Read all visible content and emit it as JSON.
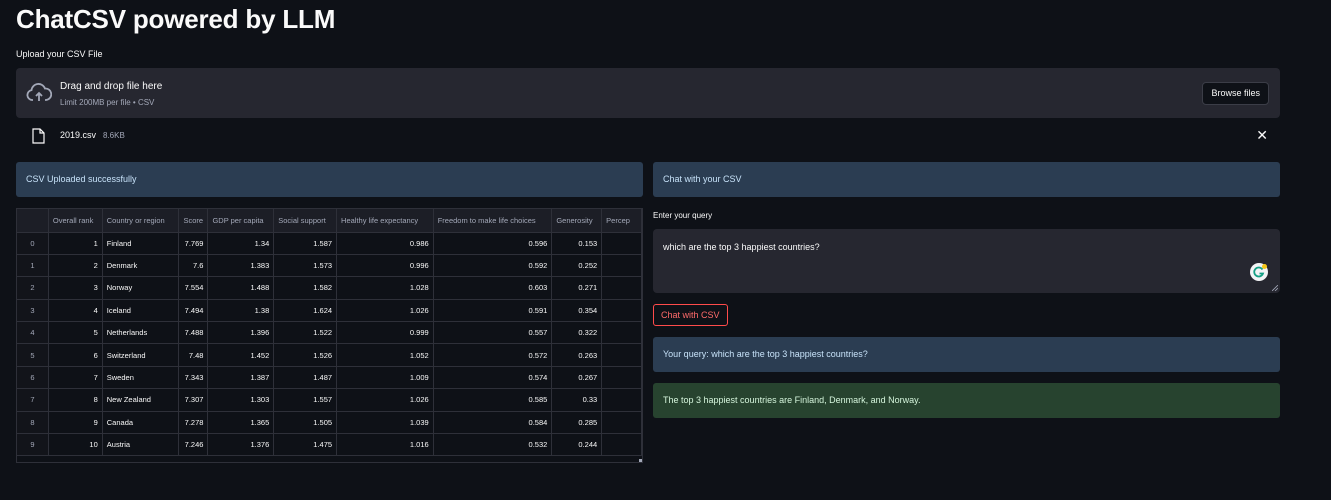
{
  "app": {
    "title": "ChatCSV powered by LLM"
  },
  "uploader": {
    "label": "Upload your CSV File",
    "drop_title": "Drag and drop file here",
    "drop_limit": "Limit 200MB per file • CSV",
    "browse_label": "Browse files",
    "file_name": "2019.csv",
    "file_size": "8.6KB"
  },
  "left_panel": {
    "upload_success": "CSV Uploaded successfully"
  },
  "table": {
    "columns": [
      "",
      "Overall rank",
      "Country or region",
      "Score",
      "GDP per capita",
      "Social support",
      "Healthy life expectancy",
      "Freedom to make life choices",
      "Generosity",
      "Percep"
    ],
    "rows": [
      [
        "0",
        "1",
        "Finland",
        "7.769",
        "1.34",
        "1.587",
        "0.986",
        "0.596",
        "0.153"
      ],
      [
        "1",
        "2",
        "Denmark",
        "7.6",
        "1.383",
        "1.573",
        "0.996",
        "0.592",
        "0.252"
      ],
      [
        "2",
        "3",
        "Norway",
        "7.554",
        "1.488",
        "1.582",
        "1.028",
        "0.603",
        "0.271"
      ],
      [
        "3",
        "4",
        "Iceland",
        "7.494",
        "1.38",
        "1.624",
        "1.026",
        "0.591",
        "0.354"
      ],
      [
        "4",
        "5",
        "Netherlands",
        "7.488",
        "1.396",
        "1.522",
        "0.999",
        "0.557",
        "0.322"
      ],
      [
        "5",
        "6",
        "Switzerland",
        "7.48",
        "1.452",
        "1.526",
        "1.052",
        "0.572",
        "0.263"
      ],
      [
        "6",
        "7",
        "Sweden",
        "7.343",
        "1.387",
        "1.487",
        "1.009",
        "0.574",
        "0.267"
      ],
      [
        "7",
        "8",
        "New Zealand",
        "7.307",
        "1.303",
        "1.557",
        "1.026",
        "0.585",
        "0.33"
      ],
      [
        "8",
        "9",
        "Canada",
        "7.278",
        "1.365",
        "1.505",
        "1.039",
        "0.584",
        "0.285"
      ],
      [
        "9",
        "10",
        "Austria",
        "7.246",
        "1.376",
        "1.475",
        "1.016",
        "0.532",
        "0.244"
      ]
    ]
  },
  "chat": {
    "header": "Chat with your CSV",
    "query_label": "Enter your query",
    "query_value": "which are the top 3 happiest countries?",
    "button_label": "Chat with CSV",
    "your_query": "Your query: which are the top 3 happiest countries?",
    "answer": "The top 3 happiest countries are Finland, Denmark, and Norway."
  },
  "colors": {
    "background": "#0e1117",
    "info": "#2b3d52",
    "success": "#27432f",
    "accent": "#ff4b4b"
  }
}
